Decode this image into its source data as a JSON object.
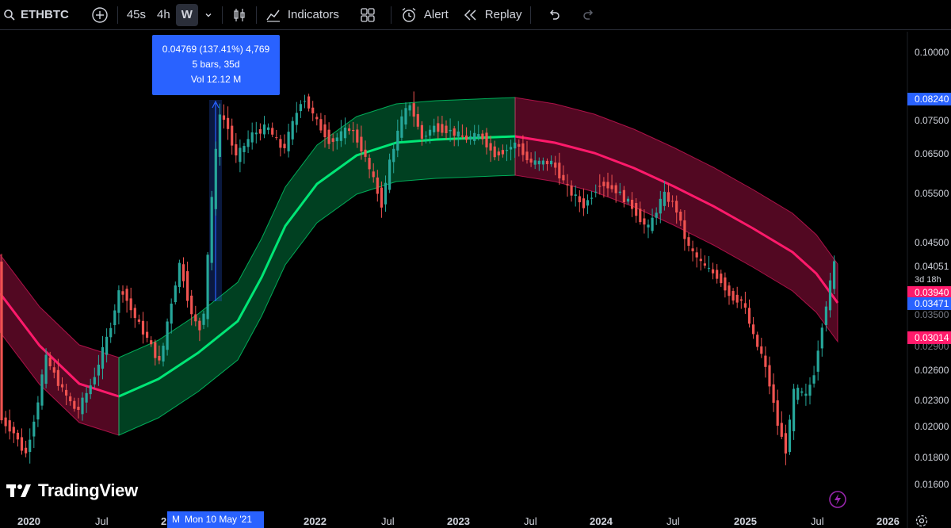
{
  "toolbar": {
    "symbol": "ETHBTC",
    "timeframes": [
      "45s",
      "4h",
      "W"
    ],
    "active_timeframe": "W",
    "indicators_label": "Indicators",
    "alert_label": "Alert",
    "replay_label": "Replay"
  },
  "measure": {
    "line1": "0.04769 (137.41%) 4,769",
    "line2": "5 bars, 35d",
    "line3": "Vol 12.12 M"
  },
  "crosshair_date_prefix": "M",
  "crosshair_date": "Mon 10 May '21",
  "price_axis": [
    "0.10000",
    "0.07500",
    "0.06500",
    "0.05500",
    "0.04500",
    "0.04051",
    "0.03500",
    "0.02900",
    "0.02600",
    "0.02300",
    "0.02000",
    "0.01800",
    "0.01600"
  ],
  "price_tags": {
    "top": "0.08240",
    "current": "0.04051",
    "countdown": "3d 18h",
    "band_upper": "0.03940",
    "band_mid": "0.03471",
    "band_lower": "0.03014"
  },
  "time_axis": [
    "2020",
    "Jul",
    "2",
    "2022",
    "Jul",
    "2023",
    "Jul",
    "2024",
    "Jul",
    "2025",
    "Jul",
    "2026"
  ],
  "brand": "TradingView",
  "colors": {
    "bull": "#26a69a",
    "bear": "#ef5350",
    "band_green": "#00e676",
    "band_red": "#ff1a6b",
    "accent": "#2962ff"
  }
}
